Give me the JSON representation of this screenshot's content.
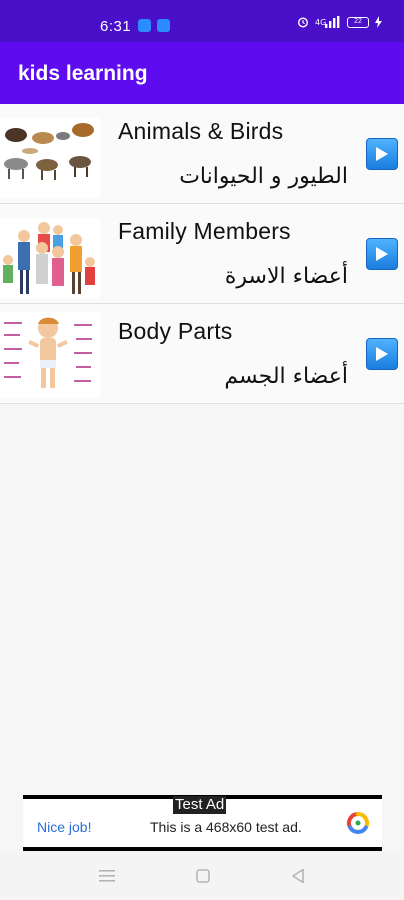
{
  "status_bar": {
    "time": "6:31",
    "battery": "22"
  },
  "app_bar": {
    "title": "kids learning",
    "color": "#5e0bf0"
  },
  "list": {
    "items": [
      {
        "title_en": "Animals & Birds",
        "title_ar": "الطيور و الحيوانات",
        "thumbnail_icon": "animals-thumbnail"
      },
      {
        "title_en": "Family Members",
        "title_ar": "أعضاء الاسرة",
        "thumbnail_icon": "family-thumbnail"
      },
      {
        "title_en": "Body Parts",
        "title_ar": "أعضاء الجسم",
        "thumbnail_icon": "body-parts-thumbnail"
      }
    ]
  },
  "ad": {
    "tag": "Test Ad",
    "nice": "Nice job!",
    "text": "This is a 468x60 test ad."
  }
}
